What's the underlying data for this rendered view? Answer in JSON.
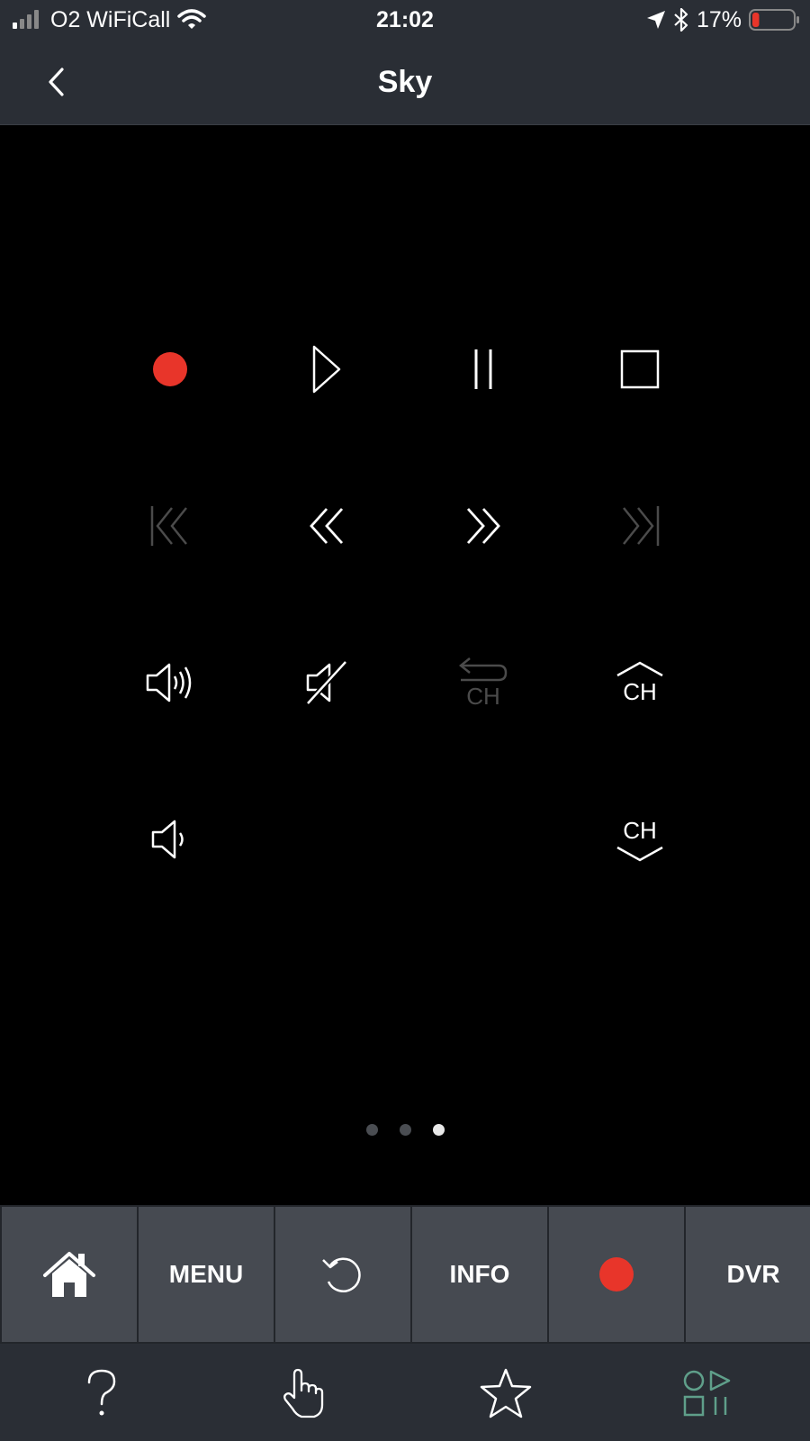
{
  "status_bar": {
    "carrier": "O2 WiFiCall",
    "time": "21:02",
    "battery_percent": "17%",
    "battery_level": 0.17,
    "icons": [
      "signal-icon",
      "wifi-icon",
      "location-icon",
      "bluetooth-icon",
      "battery-icon"
    ]
  },
  "nav": {
    "title": "Sky",
    "back_icon": "chevron-left-icon"
  },
  "remote": {
    "buttons": [
      {
        "name": "record-button",
        "icon": "record-icon"
      },
      {
        "name": "play-button",
        "icon": "play-icon"
      },
      {
        "name": "pause-button",
        "icon": "pause-icon"
      },
      {
        "name": "stop-button",
        "icon": "stop-icon"
      },
      {
        "name": "skip-back-button",
        "icon": "skip-back-icon",
        "disabled": true
      },
      {
        "name": "rewind-button",
        "icon": "rewind-icon"
      },
      {
        "name": "fast-forward-button",
        "icon": "fast-forward-icon"
      },
      {
        "name": "skip-forward-button",
        "icon": "skip-forward-icon",
        "disabled": true
      },
      {
        "name": "volume-up-button",
        "icon": "volume-up-icon"
      },
      {
        "name": "mute-button",
        "icon": "mute-icon"
      },
      {
        "name": "channel-return-button",
        "icon": "channel-return-icon",
        "disabled": true
      },
      {
        "name": "channel-up-button",
        "icon": "channel-up-icon"
      },
      {
        "name": "volume-down-button",
        "icon": "volume-down-icon"
      },
      {
        "name": "channel-down-button",
        "icon": "channel-down-icon"
      }
    ],
    "ch_label": "CH"
  },
  "pager": {
    "pages": 3,
    "active_index": 2
  },
  "quick_bar": {
    "home_icon": "home-icon",
    "menu_label": "MENU",
    "back_icon": "undo-icon",
    "info_label": "INFO",
    "record_icon": "record-icon",
    "dvr_label": "DVR"
  },
  "tab_bar": {
    "tabs": [
      "help-icon",
      "gesture-icon",
      "favorites-icon",
      "shapes-icon"
    ]
  },
  "colors": {
    "record_red": "#e8352a",
    "bar_bg": "#2a2e35",
    "quick_btn_bg": "#464a51",
    "active_tab": "#5f9f8a",
    "disabled_icon": "#4b4b4b"
  }
}
